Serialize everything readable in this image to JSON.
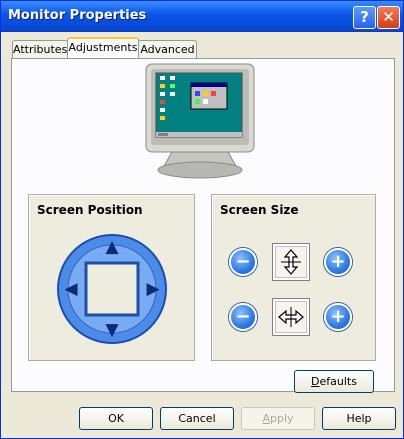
{
  "window": {
    "title": "Monitor Properties",
    "help_glyph": "?",
    "close_glyph": "✕"
  },
  "tabs": [
    {
      "label": "Attributes"
    },
    {
      "label": "Adjustments"
    },
    {
      "label": "Advanced"
    }
  ],
  "screen_position": {
    "title": "Screen Position",
    "arrows": {
      "up": "▲",
      "down": "▼",
      "left": "◀",
      "right": "▶"
    }
  },
  "screen_size": {
    "title": "Screen Size",
    "minus": "−",
    "plus": "+",
    "vertical_icon": "vertical-size-icon",
    "horizontal_icon": "horizontal-size-icon"
  },
  "buttons": {
    "defaults_u": "D",
    "defaults_rest": "efaults",
    "ok": "OK",
    "cancel": "Cancel",
    "apply_u": "A",
    "apply_rest": "pply",
    "help": "Help"
  },
  "colors": {
    "titlebar": "#0a55e6",
    "dialog_bg": "#ece9d8",
    "accent_blue": "#2f79e0"
  }
}
